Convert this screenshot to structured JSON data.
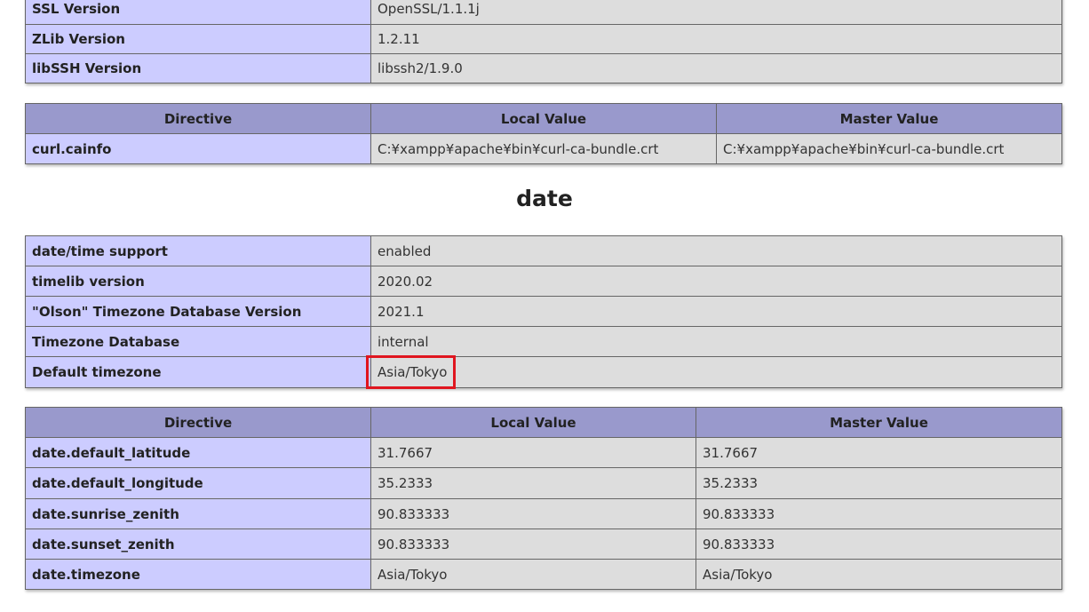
{
  "curl_info": {
    "rows": [
      {
        "name": "SSL Version",
        "value": "OpenSSL/1.1.1j"
      },
      {
        "name": "ZLib Version",
        "value": "1.2.11"
      },
      {
        "name": "libSSH Version",
        "value": "libssh2/1.9.0"
      }
    ]
  },
  "curl_directives": {
    "headers": [
      "Directive",
      "Local Value",
      "Master Value"
    ],
    "rows": [
      {
        "directive": "curl.cainfo",
        "local": "C:¥xampp¥apache¥bin¥curl-ca-bundle.crt",
        "master": "C:¥xampp¥apache¥bin¥curl-ca-bundle.crt"
      }
    ]
  },
  "date_section": {
    "title": "date",
    "info_rows": [
      {
        "name": "date/time support",
        "value": "enabled"
      },
      {
        "name": "timelib version",
        "value": "2020.02"
      },
      {
        "name": "\"Olson\" Timezone Database Version",
        "value": "2021.1"
      },
      {
        "name": "Timezone Database",
        "value": "internal"
      },
      {
        "name": "Default timezone",
        "value": "Asia/Tokyo"
      }
    ],
    "directive_headers": [
      "Directive",
      "Local Value",
      "Master Value"
    ],
    "directive_rows": [
      {
        "directive": "date.default_latitude",
        "local": "31.7667",
        "master": "31.7667"
      },
      {
        "directive": "date.default_longitude",
        "local": "35.2333",
        "master": "35.2333"
      },
      {
        "directive": "date.sunrise_zenith",
        "local": "90.833333",
        "master": "90.833333"
      },
      {
        "directive": "date.sunset_zenith",
        "local": "90.833333",
        "master": "90.833333"
      },
      {
        "directive": "date.timezone",
        "local": "Asia/Tokyo",
        "master": "Asia/Tokyo"
      }
    ]
  },
  "highlight_color": "#e0161f"
}
